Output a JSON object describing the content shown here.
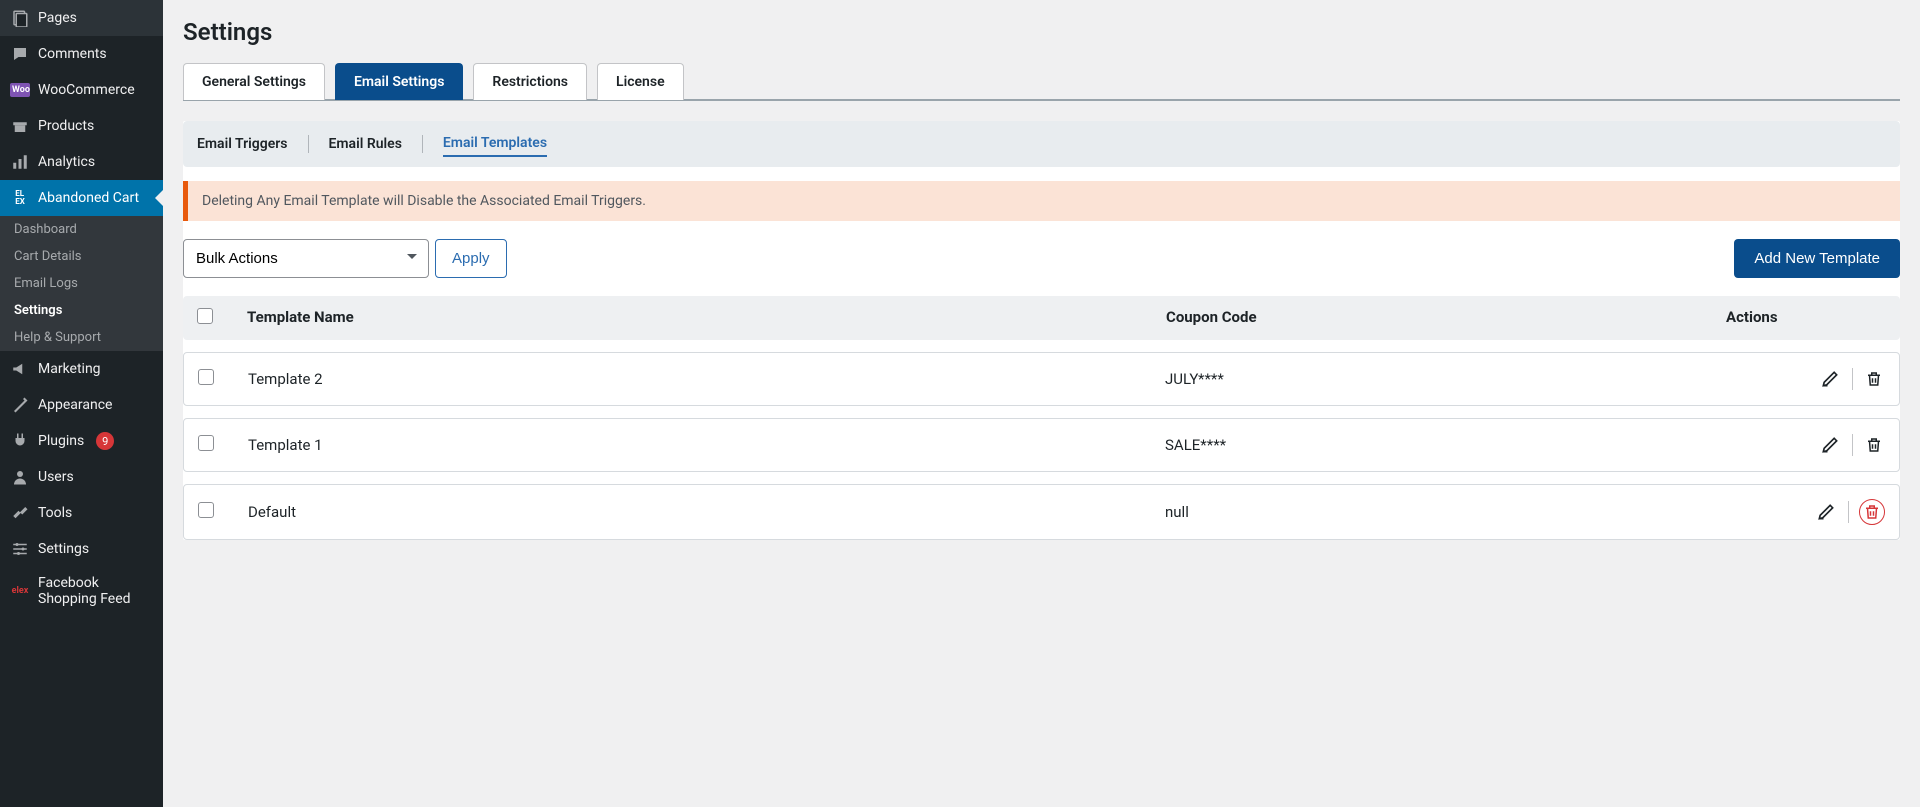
{
  "sidebar": {
    "items": [
      {
        "label": "Pages",
        "icon": "pages"
      },
      {
        "label": "Comments",
        "icon": "comment"
      },
      {
        "label": "WooCommerce",
        "icon": "woo"
      },
      {
        "label": "Products",
        "icon": "products"
      },
      {
        "label": "Analytics",
        "icon": "analytics"
      },
      {
        "label": "Abandoned Cart",
        "icon": "elex",
        "active": true
      },
      {
        "label": "Marketing",
        "icon": "marketing"
      },
      {
        "label": "Appearance",
        "icon": "appearance"
      },
      {
        "label": "Plugins",
        "icon": "plugins",
        "badge": "9"
      },
      {
        "label": "Users",
        "icon": "users"
      },
      {
        "label": "Tools",
        "icon": "tools"
      },
      {
        "label": "Settings",
        "icon": "settings"
      },
      {
        "label": "Facebook Shopping Feed",
        "icon": "feed"
      }
    ],
    "submenu": [
      {
        "label": "Dashboard"
      },
      {
        "label": "Cart Details"
      },
      {
        "label": "Email Logs"
      },
      {
        "label": "Settings",
        "current": true
      },
      {
        "label": "Help & Support"
      }
    ]
  },
  "page": {
    "title": "Settings"
  },
  "tabs": [
    {
      "label": "General Settings"
    },
    {
      "label": "Email Settings",
      "active": true
    },
    {
      "label": "Restrictions"
    },
    {
      "label": "License"
    }
  ],
  "subtabs": [
    {
      "label": "Email Triggers"
    },
    {
      "label": "Email Rules"
    },
    {
      "label": "Email Templates",
      "active": true
    }
  ],
  "notice": "Deleting Any Email Template will Disable the Associated Email Triggers.",
  "toolbar": {
    "bulk_label": "Bulk Actions",
    "apply_label": "Apply",
    "add_label": "Add New Template"
  },
  "table": {
    "headers": {
      "name": "Template Name",
      "coupon": "Coupon Code",
      "actions": "Actions"
    },
    "rows": [
      {
        "name": "Template 2",
        "coupon": "JULY****",
        "trash_danger": false
      },
      {
        "name": "Template 1",
        "coupon": "SALE****",
        "trash_danger": false
      },
      {
        "name": "Default",
        "coupon": "null",
        "trash_danger": true
      }
    ]
  }
}
